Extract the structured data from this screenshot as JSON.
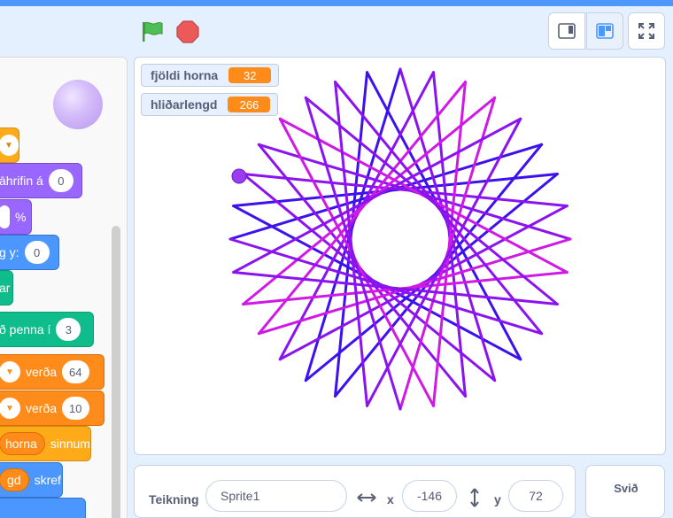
{
  "header": {
    "flag_icon": "green-flag-icon",
    "stop_icon": "stop-sign-icon",
    "view_buttons": [
      "small-stage-icon",
      "normal-stage-icon",
      "fullscreen-icon"
    ]
  },
  "code": {
    "blocks": {
      "b1_value": "",
      "b2_label": "āhrifin á",
      "b2_value": "0",
      "b3_value": "",
      "b3_suffix": "%",
      "b4_label": "g y:",
      "b4_value": "0",
      "b5_label": "ar",
      "b6_label": "ð penna í",
      "b6_value": "3",
      "b7_label": "verða",
      "b7_value": "64",
      "b8_label": "verða",
      "b8_value": "10",
      "b9_var": "horna",
      "b9_label": "sinnum",
      "b10_var": "gd",
      "b10_label": "skref"
    }
  },
  "stage": {
    "monitors": [
      {
        "label": "fjöldi horna",
        "value": "32"
      },
      {
        "label": "hliðarlengd",
        "value": "266"
      }
    ],
    "colors": {
      "blue": "#3d10ee",
      "violet": "#8b13ef",
      "magenta": "#cf1ae6"
    }
  },
  "sprite_info": {
    "sprite_label": "Teikning",
    "sprite_name": "Sprite1",
    "x_label": "x",
    "x_value": "-146",
    "y_label": "y",
    "y_value": "72"
  },
  "stage_panel": {
    "label": "Svið"
  }
}
